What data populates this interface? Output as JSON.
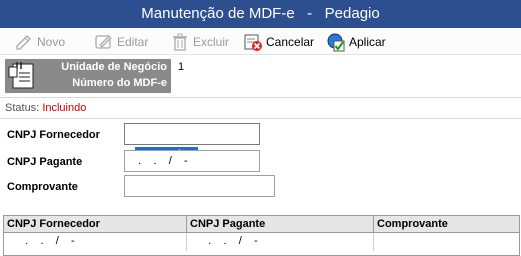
{
  "window": {
    "title": "Manutenção de MDF-e   -   Pedagio"
  },
  "toolbar": {
    "novo": "Novo",
    "editar": "Editar",
    "excluir": "Excluir",
    "cancelar": "Cancelar",
    "aplicar": "Aplicar"
  },
  "info": {
    "unidade_label": "Unidade de Negócio",
    "unidade_value": "1",
    "numero_label": "Número do MDF-e",
    "numero_value": ""
  },
  "status": {
    "label": "Status:",
    "value": "Incluindo"
  },
  "form": {
    "fornecedor_label": "CNPJ Fornecedor",
    "fornecedor_value": "   .    .    /    -",
    "pagante_label": "CNPJ Pagante",
    "pagante_value": "   .    .    /    -",
    "comprovante_label": "Comprovante",
    "comprovante_value": ""
  },
  "grid": {
    "columns": [
      "CNPJ Fornecedor",
      "CNPJ Pagante",
      "Comprovante"
    ],
    "rows": [
      [
        "   .    .    /    -",
        "   .    .    /    -",
        ""
      ]
    ]
  },
  "colors": {
    "titlebar": "#2d4e8f",
    "status_value": "#cc0000",
    "selection": "#1f6fd0"
  }
}
